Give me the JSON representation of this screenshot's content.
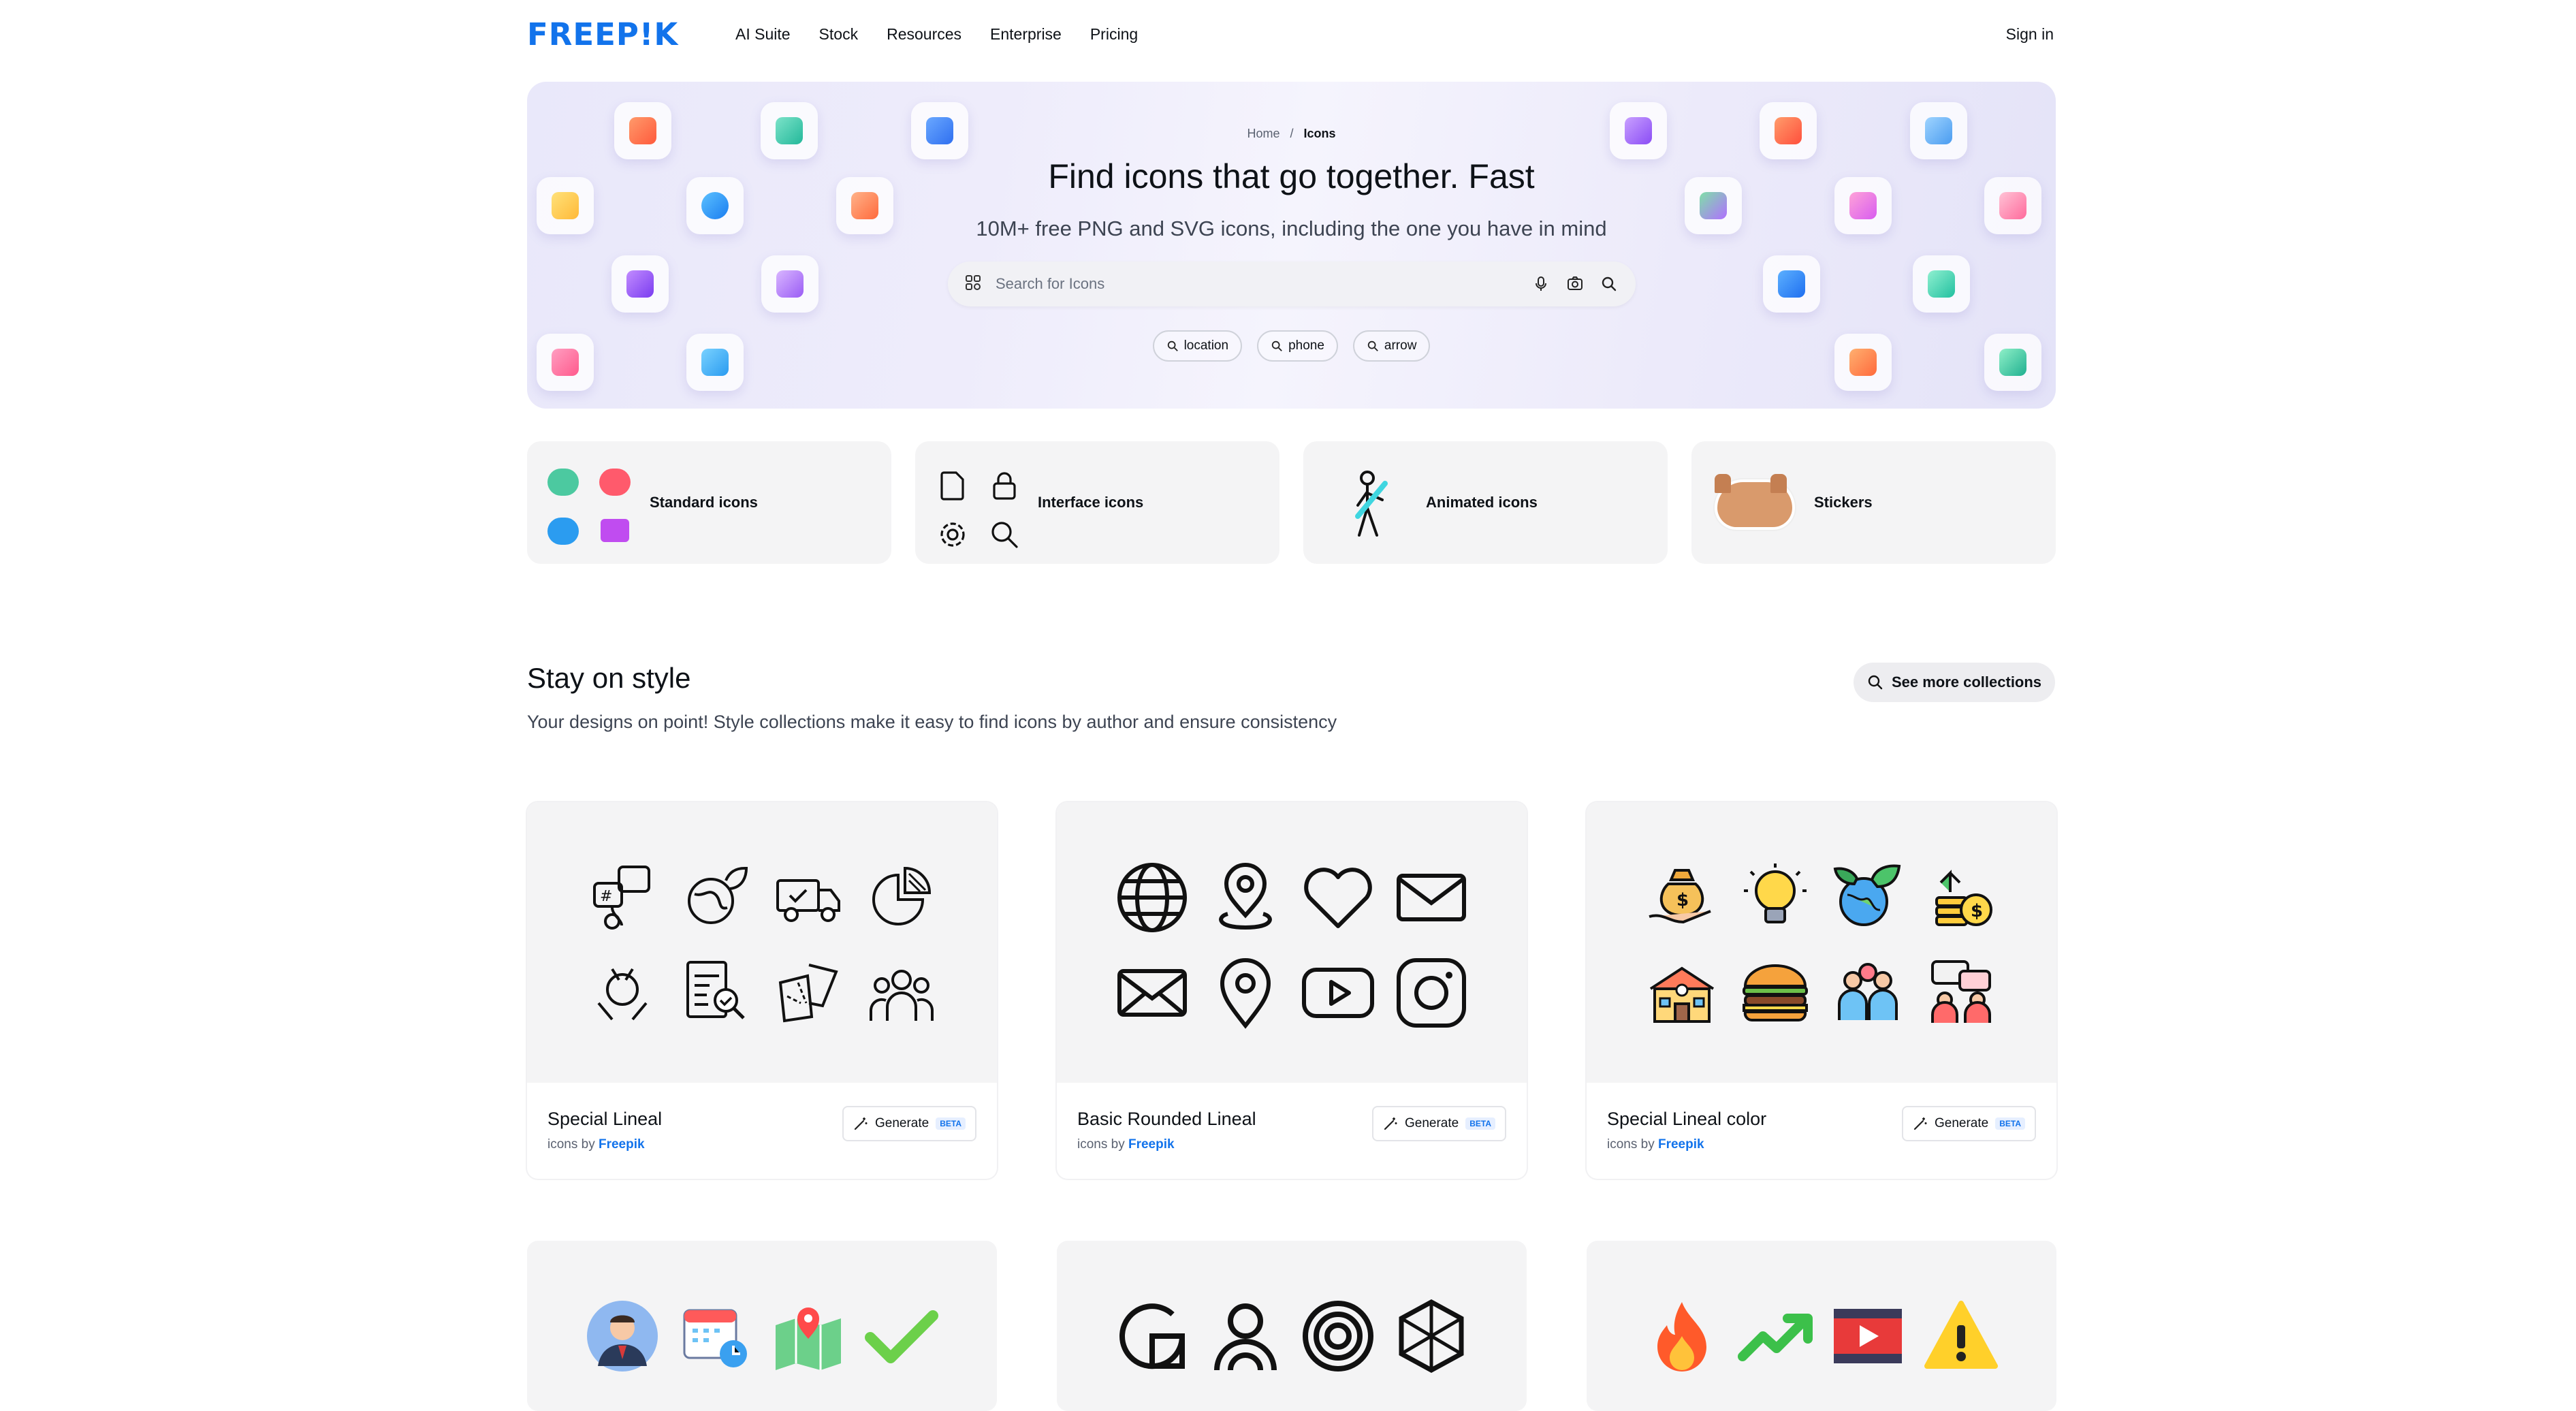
{
  "header": {
    "logo": "FREEP!K",
    "nav": [
      "AI Suite",
      "Stock",
      "Resources",
      "Enterprise",
      "Pricing"
    ],
    "signin": "Sign in"
  },
  "hero": {
    "breadcrumb_home": "Home",
    "breadcrumb_sep": "/",
    "breadcrumb_current": "Icons",
    "title": "Find icons that go together. Fast",
    "subtitle": "10M+ free PNG and SVG icons, including the one you have in mind",
    "search_placeholder": "Search for Icons",
    "chips": [
      "location",
      "phone",
      "arrow"
    ]
  },
  "categories": [
    {
      "label": "Standard icons"
    },
    {
      "label": "Interface icons"
    },
    {
      "label": "Animated icons"
    },
    {
      "label": "Stickers"
    }
  ],
  "section": {
    "title": "Stay on style",
    "subtitle": "Your designs on point! Style collections make it easy to find icons by author and ensure consistency",
    "see_more": "See more collections"
  },
  "collections": [
    {
      "name": "Special Lineal",
      "by_prefix": "icons by",
      "author": "Freepik",
      "generate": "Generate",
      "beta": "BETA"
    },
    {
      "name": "Basic Rounded Lineal",
      "by_prefix": "icons by",
      "author": "Freepik",
      "generate": "Generate",
      "beta": "BETA"
    },
    {
      "name": "Special Lineal color",
      "by_prefix": "icons by",
      "author": "Freepik",
      "generate": "Generate",
      "beta": "BETA"
    }
  ],
  "colors": {
    "brand": "#1273eb",
    "hero_bg": "#ecebfa",
    "card_bg": "#f4f4f5"
  }
}
